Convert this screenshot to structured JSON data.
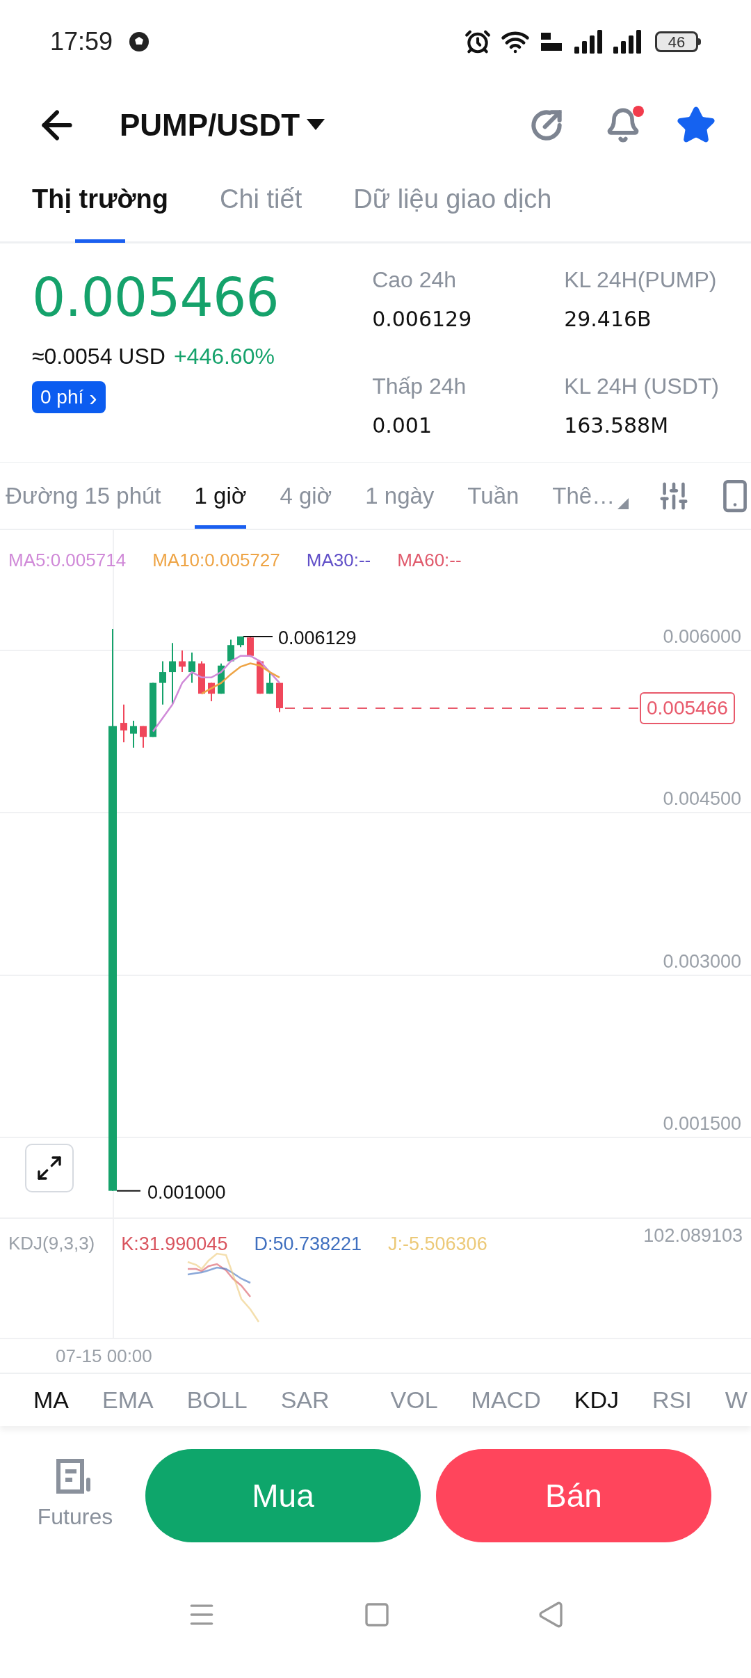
{
  "status_bar": {
    "time": "17:59",
    "battery": "46"
  },
  "header": {
    "title": "PUMP/USDT",
    "notification_dot": true,
    "favorite": true
  },
  "tabs": [
    {
      "label": "Thị trường",
      "selected": true
    },
    {
      "label": "Chi tiết",
      "selected": false
    },
    {
      "label": "Dữ liệu giao dịch",
      "selected": false
    }
  ],
  "ticker": {
    "price": "0.005466",
    "usd_value": "≈0.0054",
    "usd_unit": "USD",
    "change": "+446.60%",
    "fee_badge": "0 phí",
    "fee_badge_arrow": "›"
  },
  "stats": [
    {
      "label": "Cao 24h",
      "value": "0.006129"
    },
    {
      "label": "KL 24H(PUMP)",
      "value": "29.416B"
    },
    {
      "label": "Thấp 24h",
      "value": "0.001"
    },
    {
      "label": "KL 24H (USDT)",
      "value": "163.588M"
    }
  ],
  "timeframes": [
    {
      "label": "Đường 15 phút",
      "selected": false
    },
    {
      "label": "1 giờ",
      "selected": true
    },
    {
      "label": "4 giờ",
      "selected": false
    },
    {
      "label": "1 ngày",
      "selected": false
    },
    {
      "label": "Tuần",
      "selected": false
    },
    {
      "label": "Thê…",
      "selected": false,
      "kind": "dropdown"
    }
  ],
  "ma_legend": [
    {
      "label": "MA5:0.005714",
      "color": "#d08ad8"
    },
    {
      "label": "MA10:0.005727",
      "color": "#eea445"
    },
    {
      "label": "MA30:--",
      "color": "#6150c8"
    },
    {
      "label": "MA60:--",
      "color": "#e05a6c"
    }
  ],
  "price_axis": [
    "0.006000",
    "0.004500",
    "0.003000",
    "0.001500"
  ],
  "high_marker": "0.006129",
  "low_marker": "0.001000",
  "last_price_tag": "0.005466",
  "kdj": {
    "title": "KDJ(9,3,3)",
    "axis_max": "102.089103",
    "values": [
      {
        "label": "K:31.990045",
        "color": "#d9545e"
      },
      {
        "label": "D:50.738221",
        "color": "#3f6fbf"
      },
      {
        "label": "J:-5.506306",
        "color": "#ecc978"
      }
    ]
  },
  "time_axis": "07-15 00:00",
  "main_indicators": [
    {
      "label": "MA",
      "selected": true
    },
    {
      "label": "EMA",
      "selected": false
    },
    {
      "label": "BOLL",
      "selected": false
    },
    {
      "label": "SAR",
      "selected": false
    }
  ],
  "sub_indicators": [
    {
      "label": "VOL",
      "selected": false
    },
    {
      "label": "MACD",
      "selected": false
    },
    {
      "label": "KDJ",
      "selected": true
    },
    {
      "label": "RSI",
      "selected": false
    },
    {
      "label": "W",
      "selected": false
    }
  ],
  "actions": {
    "futures": "Futures",
    "buy": "Mua",
    "sell": "Bán"
  }
}
